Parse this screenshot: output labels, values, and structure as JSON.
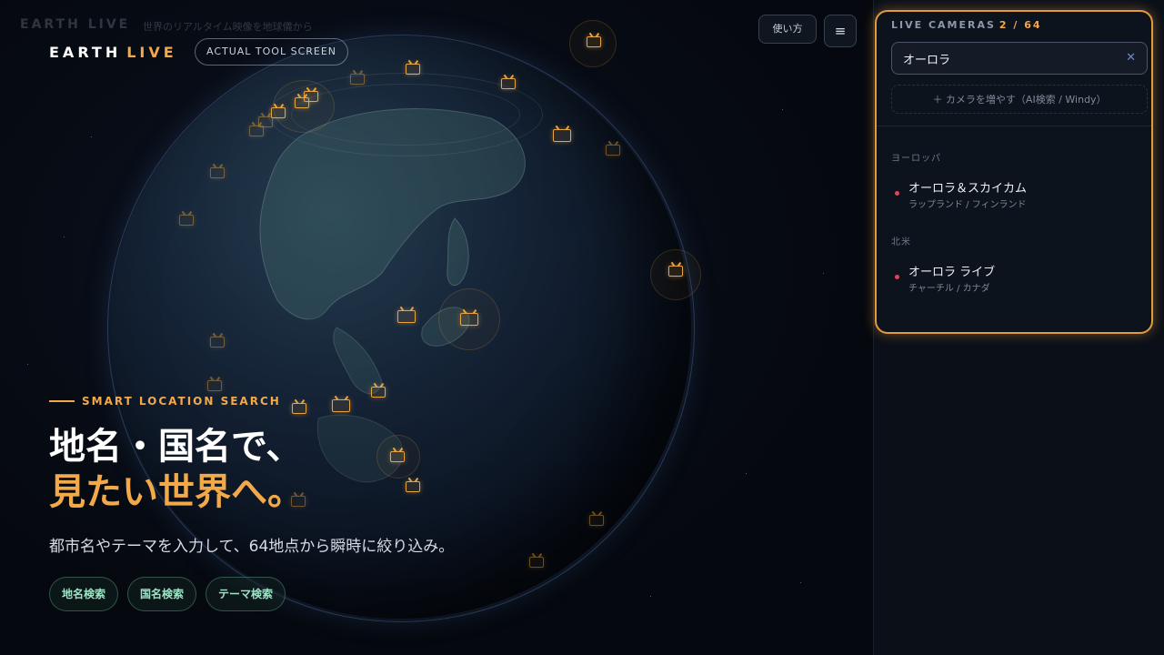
{
  "header": {
    "ghost_brand": "EARTH LIVE",
    "ghost_tagline": "世界のリアルタイム映像を地球儀から",
    "brand_earth": "EARTH",
    "brand_live": "LIVE",
    "tool_badge": "ACTUAL TOOL SCREEN",
    "help_label": "使い方",
    "menu_icon": "≡"
  },
  "hero": {
    "kicker": "SMART LOCATION SEARCH",
    "title_line1": "地名・国名で、",
    "title_line2": "見たい世界へ。",
    "lead": "都市名やテーマを入力して、64地点から瞬時に絞り込み。",
    "chips": [
      "地名検索",
      "国名検索",
      "テーマ検索"
    ]
  },
  "panel": {
    "title": "LIVE CAMERAS",
    "count": "2 / 64",
    "search_value": "オーロラ",
    "clear_icon": "✕",
    "add_camera_label": "＋ カメラを増やす（AI検索 / Windy）",
    "groups": [
      {
        "label": "ヨーロッパ",
        "items": [
          {
            "name": "オーロラ＆スカイカム",
            "location": "ラップランド / フィンランド"
          }
        ]
      },
      {
        "label": "北米",
        "items": [
          {
            "name": "オーロラ ライブ",
            "location": "チャーチル / カナダ"
          }
        ]
      }
    ]
  },
  "colors": {
    "accent": "#f2a94a",
    "panel_border": "#e39a3d",
    "chip_text": "#9fe3c6",
    "status_dot": "#e0445a"
  }
}
